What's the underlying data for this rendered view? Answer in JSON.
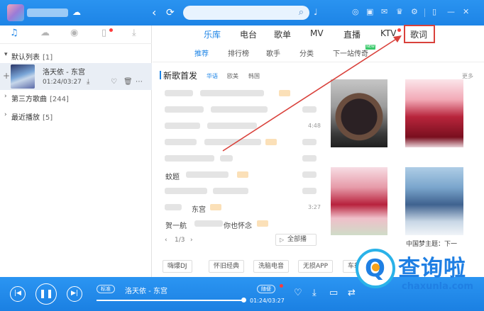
{
  "titlebar": {
    "back_icon": "chevron-left-icon",
    "refresh_icon": "refresh-icon"
  },
  "left": {
    "tabs": [
      "music-note-icon",
      "cloud-icon",
      "radio-icon",
      "device-icon",
      "download-icon"
    ],
    "groups": [
      {
        "title": "默认列表",
        "count": "[1]",
        "expanded": true
      },
      {
        "title": "第三方歌曲",
        "count": "[244]",
        "expanded": false
      },
      {
        "title": "最近播放",
        "count": "[5]",
        "expanded": false
      }
    ],
    "current_song": {
      "title": "洛天依 - 东宫",
      "time": "01:24/03:27"
    }
  },
  "topnav": {
    "items": [
      "乐库",
      "电台",
      "歌单",
      "MV",
      "直播",
      "KTV",
      "歌词"
    ],
    "active": "乐库"
  },
  "subnav": {
    "items": [
      "推荐",
      "排行榜",
      "歌手",
      "分类",
      "下一站传奇"
    ],
    "badge": "NEW"
  },
  "content": {
    "section_title": "新歌首发",
    "chips": [
      "华语",
      "欧美",
      "韩国"
    ],
    "more": "更多",
    "durations": [
      "4:48",
      "3:27"
    ],
    "visible_songs": [
      "蚊题",
      "东宫",
      "贺一航",
      "你也怀念"
    ],
    "all_play": "全部播",
    "pager": "1/3",
    "tags": [
      "嗨爆DJ",
      "怀旧经典",
      "洗脑电音",
      "无损APP",
      "车载"
    ],
    "album_caption": "中国梦主题：下一"
  },
  "player": {
    "quality": "标准",
    "title": "洛天依 - 东宫",
    "time": "01:24/03:27",
    "progress": 1.0,
    "effect": "随便"
  },
  "watermark": {
    "brand": "查询啦",
    "url": "chaxunla.com"
  },
  "colors": {
    "accent": "#1d84e6",
    "highlight": "#d9413b"
  }
}
